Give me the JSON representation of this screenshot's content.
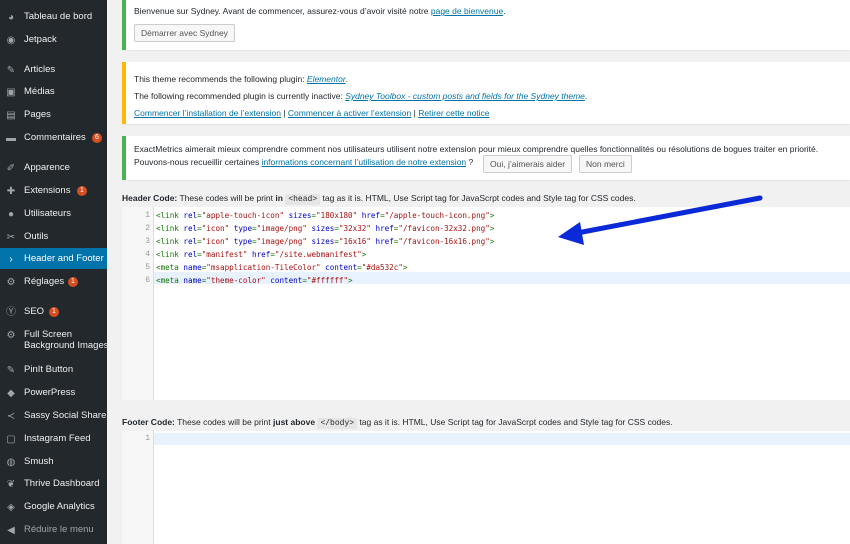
{
  "sidebar": {
    "items": [
      {
        "label": "Tableau de bord",
        "icon": "dashboard-icon",
        "glyph": "◕"
      },
      {
        "label": "Jetpack",
        "icon": "jetpack-icon",
        "glyph": "◉"
      },
      {
        "label": "Articles",
        "icon": "pin-icon",
        "glyph": "✎"
      },
      {
        "label": "Médias",
        "icon": "media-icon",
        "glyph": "▣"
      },
      {
        "label": "Pages",
        "icon": "pages-icon",
        "glyph": "▤"
      },
      {
        "label": "Commentaires",
        "icon": "comments-icon",
        "glyph": "▬",
        "badge": "6"
      },
      {
        "label": "Apparence",
        "icon": "appearance-icon",
        "glyph": "✐"
      },
      {
        "label": "Extensions",
        "icon": "plugins-icon",
        "glyph": "✚",
        "badge": "1"
      },
      {
        "label": "Utilisateurs",
        "icon": "users-icon",
        "glyph": "●"
      },
      {
        "label": "Outils",
        "icon": "tools-icon",
        "glyph": "✂"
      },
      {
        "label": "Header and Footer",
        "icon": "chevron-right-icon",
        "glyph": "›"
      },
      {
        "label": "Réglages",
        "icon": "settings-icon",
        "glyph": "⚙",
        "badge": "1"
      },
      {
        "label": "SEO",
        "icon": "seo-icon",
        "glyph": "Ⓨ",
        "badge": "1"
      },
      {
        "label": "Full Screen Background Images",
        "icon": "gear-icon",
        "glyph": "⚙"
      },
      {
        "label": "PinIt Button",
        "icon": "pin-icon",
        "glyph": "✎"
      },
      {
        "label": "PowerPress",
        "icon": "microphone-icon",
        "glyph": "◆"
      },
      {
        "label": "Sassy Social Share",
        "icon": "share-icon",
        "glyph": "≺"
      },
      {
        "label": "Instagram Feed",
        "icon": "instagram-icon",
        "glyph": "▢"
      },
      {
        "label": "Smush",
        "icon": "smush-icon",
        "glyph": "◍"
      },
      {
        "label": "Thrive Dashboard",
        "icon": "thrive-icon",
        "glyph": "❦"
      },
      {
        "label": "Google Analytics",
        "icon": "analytics-icon",
        "glyph": "◈"
      },
      {
        "label": "Réduire le menu",
        "icon": "collapse-icon",
        "glyph": "◀"
      }
    ]
  },
  "notice_welcome": {
    "text": "Bienvenue sur Sydney. Avant de commencer, assurez-vous d’avoir visité notre ",
    "link": "page de bienvenue",
    "end": ".",
    "button": "Démarrer avec Sydney"
  },
  "notice_plugin": {
    "line1_pre": "This theme recommends the following plugin: ",
    "line1_link": "Elementor",
    "line1_end": ".",
    "line2_pre": "The following recommended plugin is currently inactive: ",
    "line2_link": "Sydney Toolbox - custom posts and fields for the Sydney theme",
    "line2_end": ".",
    "action1": "Commencer l’installation de l’extension",
    "action2": "Commencer à activer l’extension",
    "action3": "Retirer cette notice",
    "sep": "|"
  },
  "notice_exactmetrics": {
    "line1": "ExactMetrics aimerait mieux comprendre comment nos utilisateurs utilisent notre extension pour mieux comprendre quelles fonctionnalités ou résolutions de bogues traiter en priorité.",
    "line2_pre": "Pouvons-nous recueillir certaines ",
    "line2_link": "informations concernant l’utilisation de notre extension",
    "line2_end": " ?",
    "yes": "Oui, j’aimerais aider",
    "no": "Non merci"
  },
  "header_code": {
    "label_a": "Header Code:",
    "label_b": " These codes will be print ",
    "label_c": "in",
    "tag": "<head>",
    "label_d": " tag as it is. HTML, Use Script tag for JavaScrpt codes and Style tag for CSS codes.",
    "line_numbers": [
      "1",
      "2",
      "3",
      "4",
      "5",
      "6"
    ],
    "lines": [
      "<link rel=\"apple-touch-icon\" sizes=\"180x180\" href=\"/apple-touch-icon.png\">",
      "<link rel=\"icon\" type=\"image/png\" sizes=\"32x32\" href=\"/favicon-32x32.png\">",
      "<link rel=\"icon\" type=\"image/png\" sizes=\"16x16\" href=\"/favicon-16x16.png\">",
      "<link rel=\"manifest\" href=\"/site.webmanifest\">",
      "<meta name=\"msapplication-TileColor\" content=\"#da532c\">",
      "<meta name=\"theme-color\" content=\"#ffffff\">"
    ]
  },
  "footer_code": {
    "label_a": "Footer Code:",
    "label_b": " These codes will be print ",
    "label_c": "just above",
    "tag": "</body>",
    "label_d": " tag as it is. HTML, Use Script tag for JavaScrpt codes and Style tag for CSS codes.",
    "line_numbers": [
      "1"
    ]
  },
  "colors": {
    "arrow": "#0a2ad8",
    "accent": "#0073aa",
    "warning": "#ffb900",
    "info": "#00a0d2"
  }
}
